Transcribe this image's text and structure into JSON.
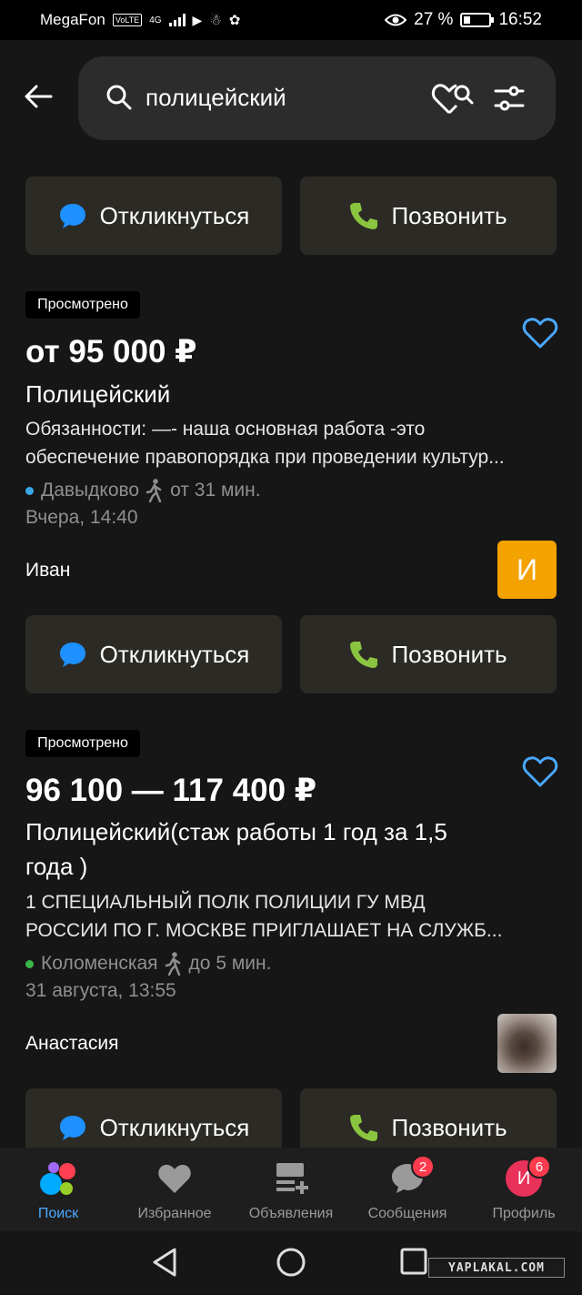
{
  "status_bar": {
    "carrier": "MegaFon",
    "volte": "VoLTE",
    "network": "4G",
    "battery_percent": "27 %",
    "battery_level": 0.27,
    "time": "16:52"
  },
  "search": {
    "query": "полицейский"
  },
  "buttons": {
    "respond": "Откликнуться",
    "call": "Позвонить"
  },
  "listings": [
    {
      "viewed": "Просмотрено",
      "price": "от 95 000 ₽",
      "title": "Полицейский",
      "description_line1": "Обязанности: —- наша основная работа -это",
      "description_line2": "обеспечение правопорядка при проведении культур...",
      "metro": "Давыдково",
      "metro_color": "#3aa8e8",
      "walk": "от 31 мин.",
      "date": "Вчера, 14:40",
      "author": "Иван",
      "avatar_letter": "И"
    },
    {
      "viewed": "Просмотрено",
      "price": "96 100 — 117 400 ₽",
      "title_line1": "Полицейский(стаж работы 1 год за 1,5",
      "title_line2": "года )",
      "description_line1": "1 СПЕЦИАЛЬНЫЙ ПОЛК ПОЛИЦИИ ГУ МВД",
      "description_line2": "РОССИИ ПО Г. МОСКВЕ ПРИГЛАШАЕТ НА СЛУЖБ...",
      "metro": "Коломенская",
      "metro_color": "#3bb54a",
      "walk": "до 5 мин.",
      "date": "31 августа, 13:55",
      "author": "Анастасия"
    }
  ],
  "bottom_nav": {
    "search": "Поиск",
    "favorites": "Избранное",
    "ads": "Объявления",
    "messages": "Сообщения",
    "messages_badge": "2",
    "profile": "Профиль",
    "profile_badge": "6",
    "profile_letter": "И"
  },
  "watermark": "YAPLAKAL.COM",
  "colors": {
    "accent_blue": "#4aa8ff",
    "phone_green": "#8bc540",
    "chat_blue": "#1e90ff",
    "avatar_orange": "#f4a200",
    "badge_red": "#ff3b4e"
  }
}
